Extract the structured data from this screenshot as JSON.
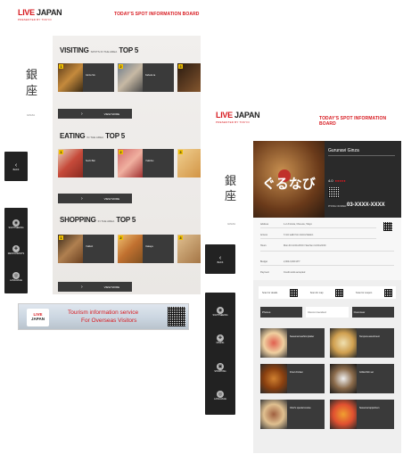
{
  "left_screen": {
    "logo_live": "LIVE",
    "logo_japan": "JAPAN",
    "logo_sub": "PRESENTED BY TOKYO",
    "board_title": "TODAY'S SPOT INFORMATION BOARD",
    "area_kanji_1": "銀",
    "area_kanji_2": "座",
    "area_label": "GINZA",
    "back_label": "BACK",
    "sidebar_items": [
      {
        "label": "SIGHTSEEING",
        "icon": "camera-icon"
      },
      {
        "label": "RESTAURANTS",
        "icon": "restaurant-icon"
      },
      {
        "label": "LANGUAGE",
        "icon": "language-icon"
      }
    ],
    "sections": [
      {
        "title": "VISITING",
        "subtitle": "SPOTS IN THE AREA",
        "top": "TOP 5",
        "cards": [
          {
            "rank": "1",
            "name": "Ginza Six"
          },
          {
            "rank": "2",
            "name": "Kabuki-za"
          },
          {
            "rank": "3",
            "name": ""
          }
        ],
        "more": "VIEW MORE"
      },
      {
        "title": "EATING",
        "subtitle": "IN THE AREA",
        "top": "TOP 5",
        "cards": [
          {
            "rank": "1",
            "name": "Sushi Bar"
          },
          {
            "rank": "2",
            "name": "Yakiniku"
          },
          {
            "rank": "3",
            "name": ""
          }
        ],
        "more": "VIEW MORE"
      },
      {
        "title": "SHOPPING",
        "subtitle": "IN THE AREA",
        "top": "TOP 5",
        "cards": [
          {
            "rank": "1",
            "name": "Yakitori"
          },
          {
            "rank": "2",
            "name": "Izakaya"
          },
          {
            "rank": "3",
            "name": ""
          }
        ],
        "more": "VIEW MORE"
      }
    ]
  },
  "banner": {
    "logo_live": "LIVE",
    "logo_japan": "JAPAN",
    "text_1": "Tourism information service",
    "text_2": "For Overseas Visitors"
  },
  "right_screen": {
    "logo_live": "LIVE",
    "logo_japan": "JAPAN",
    "logo_sub": "PRESENTED BY TOKYO",
    "board_title": "TODAY'S SPOT INFORMATION BOARD",
    "area_kanji_1": "銀",
    "area_kanji_2": "座",
    "area_label": "GINZA",
    "back_label": "BACK",
    "sidebar_items": [
      {
        "label": "SIGHTSEEING",
        "icon": "camera-icon"
      },
      {
        "label": "DINING",
        "icon": "restaurant-icon"
      },
      {
        "label": "SHOPPING",
        "icon": "bag-icon"
      },
      {
        "label": "LANGUAGE",
        "icon": "language-icon"
      }
    ],
    "hero": {
      "brand_jp": "ぐるなび",
      "name": "Gurunavi Ginza",
      "rating_label": "4.0",
      "phone_label": "PHONE NUMBER",
      "phone": "03-XXXX-XXXX"
    },
    "info_rows": [
      {
        "label": "Address",
        "value": "1-2-3 Ginza, Chuo-ku, Tokyo"
      },
      {
        "label": "Access",
        "value": "3 min walk from Ginza Station"
      },
      {
        "label": "Hours",
        "value": "Mon-Fri 11:00-23:00 / Sat-Sun 11:00-22:00"
      },
      {
        "label": "Budget",
        "value": "2,000-3,000 JPY"
      },
      {
        "label": "Payment",
        "value": "Credit cards accepted"
      }
    ],
    "qr_labels": [
      "Scan for details",
      "Scan for map",
      "Scan for coupon"
    ],
    "tabs": [
      "Photos",
      "Recommended",
      "Overview"
    ],
    "dishes": [
      {
        "name": "Seasonal sashimi platter"
      },
      {
        "name": "Tempura assortment"
      },
      {
        "name": "Fried chicken"
      },
      {
        "name": "Grilled fish set"
      },
      {
        "name": "Chef's special course"
      },
      {
        "name": "Seasonal appetizers"
      }
    ]
  }
}
